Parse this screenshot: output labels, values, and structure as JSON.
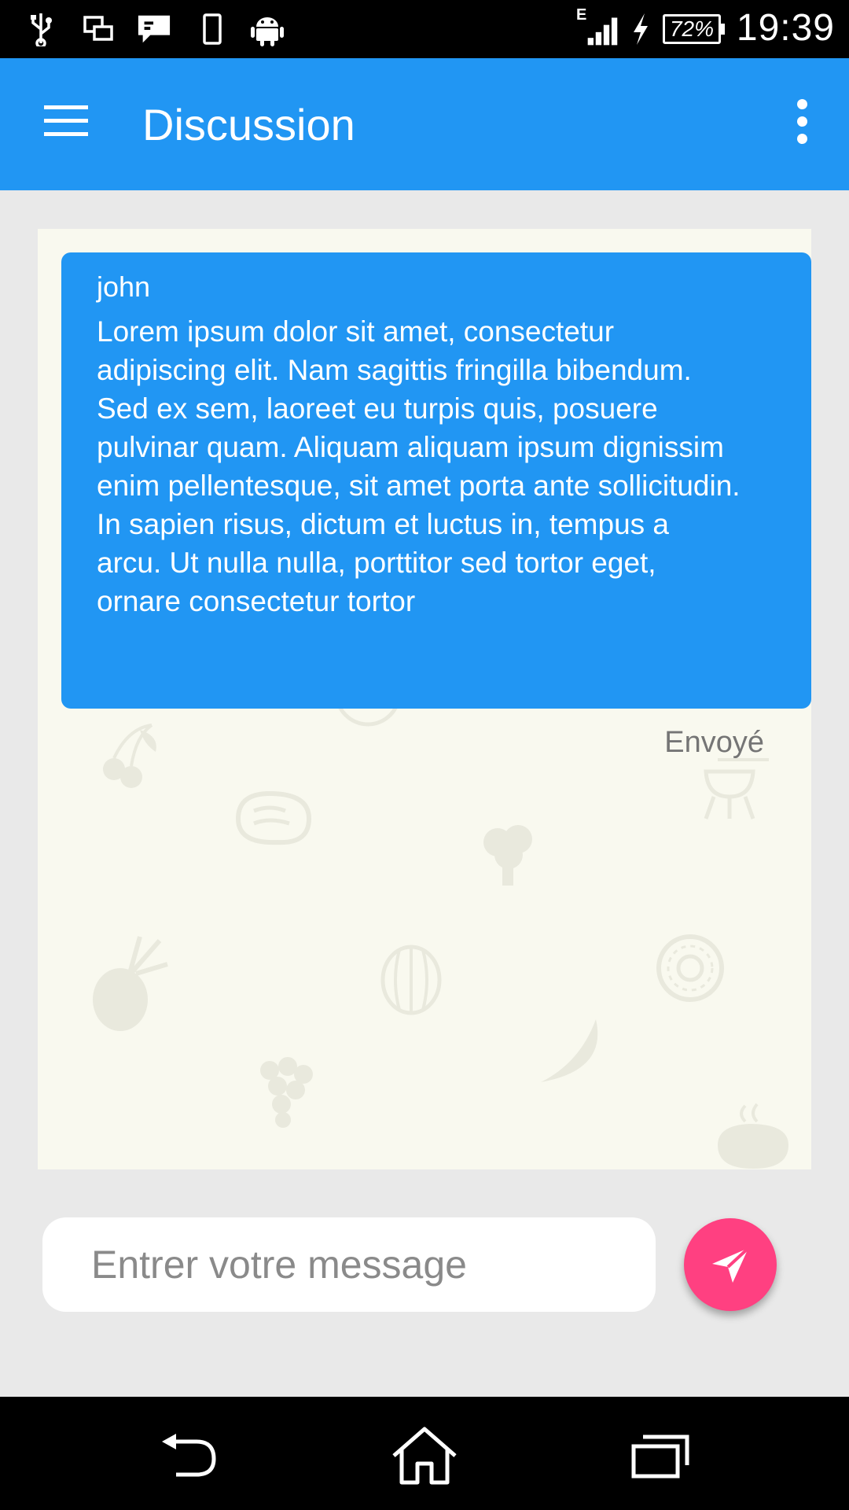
{
  "status_bar": {
    "icons": [
      "usb-icon",
      "screen-cast-icon",
      "message-icon",
      "phone-icon",
      "android-icon",
      "network-e-icon",
      "signal-icon",
      "charging-icon",
      "battery-icon"
    ],
    "network_type": "E",
    "battery": "72%",
    "time": "19:39"
  },
  "app_bar": {
    "title": "Discussion",
    "menu_icon": "hamburger-menu-icon",
    "overflow_icon": "more-vert-icon",
    "color": "#2196f3"
  },
  "chat": {
    "messages": [
      {
        "author": "john",
        "text": "Lorem ipsum dolor sit amet, consectetur adipiscing elit. Nam sagittis fringilla bibendum. Sed ex sem, laoreet eu turpis quis, posuere pulvinar quam. Aliquam aliquam ipsum dignissim enim pellentesque, sit amet porta ante sollicitudin. In sapien risus, dictum et luctus in, tempus a arcu. Ut nulla nulla, porttitor sed tortor eget, ornare consectetur tortor",
        "status": "Envoyé",
        "bubble_color": "#2196f3"
      }
    ],
    "background_color": "#f9f9ef"
  },
  "composer": {
    "placeholder": "Entrer votre message",
    "value": "",
    "send_icon": "send-icon",
    "send_color": "#ff4081"
  },
  "nav_bar": {
    "icons": [
      "back-icon",
      "home-icon",
      "recent-apps-icon"
    ]
  }
}
